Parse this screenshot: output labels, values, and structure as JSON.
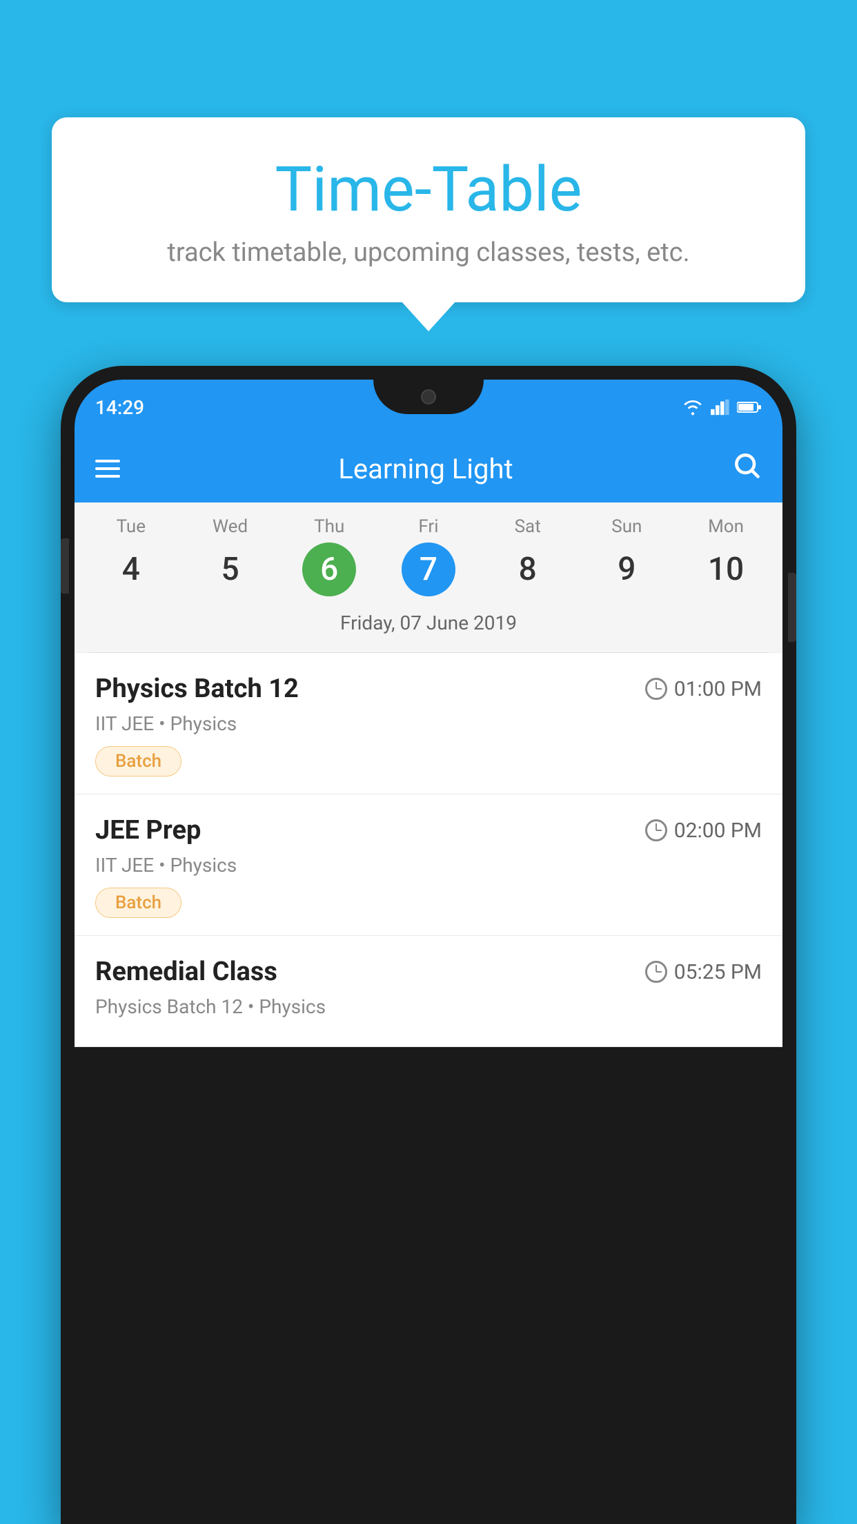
{
  "background": {
    "color": "#29b6e8"
  },
  "tooltip": {
    "title": "Time-Table",
    "subtitle": "track timetable, upcoming classes, tests, etc."
  },
  "phone": {
    "status_bar": {
      "time": "14:29",
      "icons": [
        "wifi",
        "signal",
        "battery"
      ]
    },
    "app_bar": {
      "title": "Learning Light",
      "menu_icon": "hamburger-icon",
      "search_icon": "search-icon"
    },
    "calendar": {
      "days": [
        {
          "label": "Tue",
          "number": "4",
          "state": "normal"
        },
        {
          "label": "Wed",
          "number": "5",
          "state": "normal"
        },
        {
          "label": "Thu",
          "number": "6",
          "state": "today"
        },
        {
          "label": "Fri",
          "number": "7",
          "state": "selected"
        },
        {
          "label": "Sat",
          "number": "8",
          "state": "normal"
        },
        {
          "label": "Sun",
          "number": "9",
          "state": "normal"
        },
        {
          "label": "Mon",
          "number": "10",
          "state": "normal"
        }
      ],
      "selected_date_label": "Friday, 07 June 2019"
    },
    "schedule": [
      {
        "title": "Physics Batch 12",
        "time": "01:00 PM",
        "subtitle": "IIT JEE • Physics",
        "badge": "Batch"
      },
      {
        "title": "JEE Prep",
        "time": "02:00 PM",
        "subtitle": "IIT JEE • Physics",
        "badge": "Batch"
      },
      {
        "title": "Remedial Class",
        "time": "05:25 PM",
        "subtitle": "Physics Batch 12 • Physics",
        "badge": ""
      }
    ]
  }
}
